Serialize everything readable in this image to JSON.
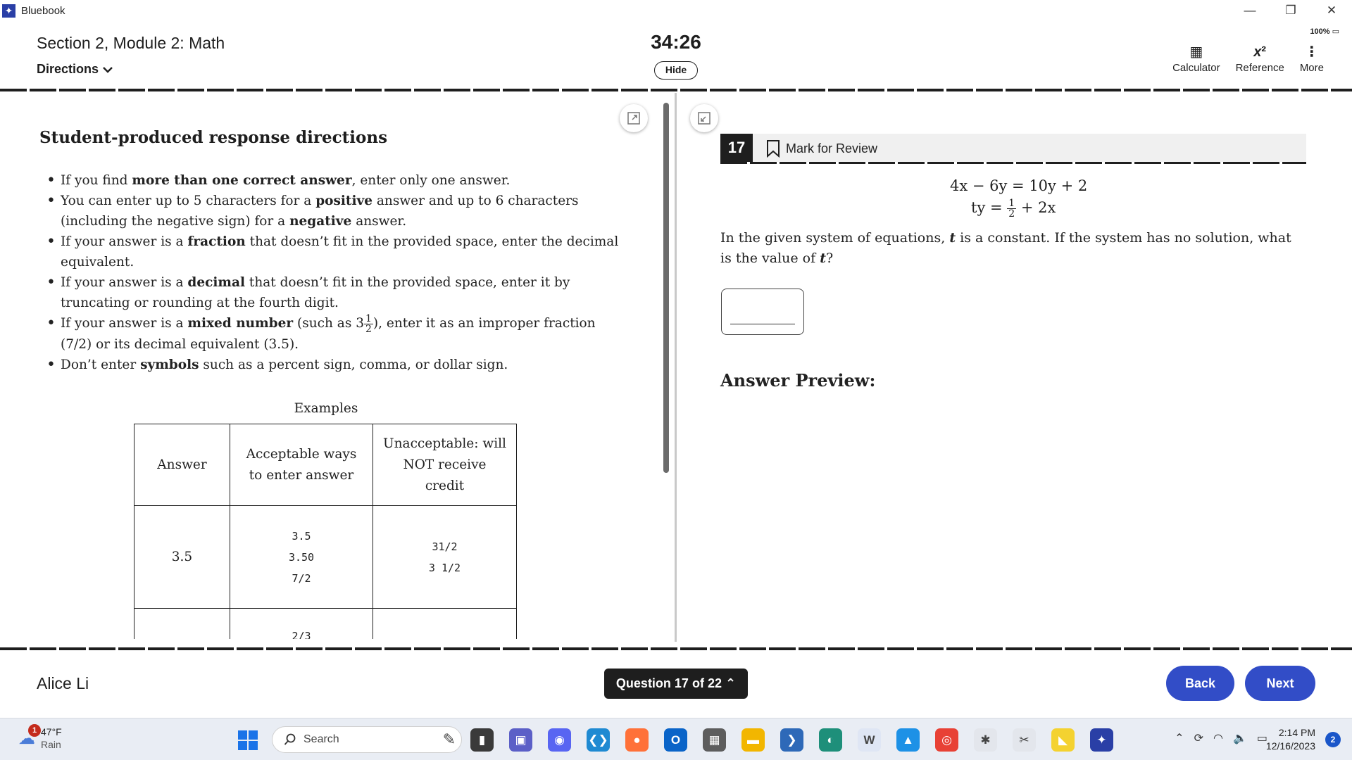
{
  "window": {
    "app_title": "Bluebook",
    "controls": [
      "—",
      "❐",
      "✕"
    ]
  },
  "header": {
    "section_title": "Section 2, Module 2: Math",
    "directions_label": "Directions",
    "timer": "34:26",
    "hide_label": "Hide",
    "battery": "100%",
    "tools": [
      {
        "label": "Calculator",
        "icon": "calculator-icon"
      },
      {
        "label": "Reference",
        "icon": "reference-icon"
      },
      {
        "label": "More",
        "icon": "more-vertical-icon"
      }
    ]
  },
  "directions_panel": {
    "title": "Student-produced response directions",
    "rules": [
      {
        "pre": "If you find ",
        "bold": "more than one correct answer",
        "post": ", enter only one answer."
      },
      {
        "pre": "You can enter up to 5 characters for a ",
        "bold": "positive",
        "mid": " answer and up to 6 characters (including the negative sign) for a ",
        "bold2": "negative",
        "post": " answer."
      },
      {
        "pre": "If your answer is a ",
        "bold": "fraction",
        "post": " that doesn’t fit in the provided space, enter the decimal equivalent."
      },
      {
        "pre": "If your answer is a ",
        "bold": "decimal",
        "post": " that doesn’t fit in the provided space, enter it by truncating or rounding at the fourth digit."
      },
      {
        "pre": "If your answer is a ",
        "bold": "mixed number",
        "mid": " (such as 3",
        "frac_num": "1",
        "frac_den": "2",
        "post": "), enter it as an improper fraction (7/2) or its decimal equivalent (3.5)."
      },
      {
        "pre": "Don’t enter ",
        "bold": "symbols",
        "post": " such as a percent sign, comma, or dollar sign."
      }
    ],
    "examples_caption": "Examples",
    "table": {
      "headers": [
        "Answer",
        "Acceptable ways to enter answer",
        "Unacceptable: will NOT receive credit"
      ],
      "rows": [
        {
          "answer": "3.5",
          "acceptable": [
            "3.5",
            "3.50",
            "7/2"
          ],
          "unacceptable": [
            "31/2",
            "3 1/2"
          ]
        },
        {
          "answer": "",
          "acceptable": [
            "2/3"
          ],
          "unacceptable": []
        }
      ]
    }
  },
  "question": {
    "number": "17",
    "mark_for_review": "Mark for Review",
    "equation_1": "4x − 6y = 10y + 2",
    "equation_2_lhs": "ty = ",
    "equation_2_frac_num": "1",
    "equation_2_frac_den": "2",
    "equation_2_rhs": " + 2x",
    "text_pre": "In the given system of equations, ",
    "text_var": "t",
    "text_mid": " is a constant. If the system has no solution, what is the value of ",
    "text_var2": "t",
    "text_post": "?",
    "answer_preview_label": "Answer Preview:"
  },
  "footer": {
    "user_name": "Alice Li",
    "question_nav": "Question 17 of 22",
    "back_label": "Back",
    "next_label": "Next"
  },
  "taskbar": {
    "weather_temp": "47°F",
    "weather_desc": "Rain",
    "weather_badge": "1",
    "search_placeholder": "Search",
    "time": "2:14 PM",
    "date": "12/16/2023",
    "notifications": "2",
    "pinned": [
      {
        "name": "file-explorer",
        "color": "#3a3a3a",
        "glyph": "▮"
      },
      {
        "name": "teams",
        "color": "#5b5fc7",
        "glyph": "▣"
      },
      {
        "name": "discord",
        "color": "#5865f2",
        "glyph": "◉"
      },
      {
        "name": "vscode",
        "color": "#1f8ad2",
        "glyph": "❮❯"
      },
      {
        "name": "firefox",
        "color": "#ff7139",
        "glyph": "●"
      },
      {
        "name": "outlook",
        "color": "#0a64c8",
        "glyph": "O"
      },
      {
        "name": "calculator",
        "color": "#5d5d5d",
        "glyph": "▦"
      },
      {
        "name": "folder",
        "color": "#f2b600",
        "glyph": "▬"
      },
      {
        "name": "powershell",
        "color": "#2e69b8",
        "glyph": "❯"
      },
      {
        "name": "edge",
        "color": "#1e8f7a",
        "glyph": "◐"
      },
      {
        "name": "word-app",
        "color": "#dfe6f4",
        "glyph": "W"
      },
      {
        "name": "docker",
        "color": "#1d91e6",
        "glyph": "▲"
      },
      {
        "name": "chrome",
        "color": "#e84135",
        "glyph": "◎"
      },
      {
        "name": "slack",
        "color": "#e3e6ec",
        "glyph": "✱"
      },
      {
        "name": "snipping-tool",
        "color": "#e3e6ec",
        "glyph": "✂"
      },
      {
        "name": "sticky-notes",
        "color": "#f4d230",
        "glyph": "◣"
      },
      {
        "name": "bluebook",
        "color": "#2a3fa6",
        "glyph": "✦"
      }
    ]
  }
}
